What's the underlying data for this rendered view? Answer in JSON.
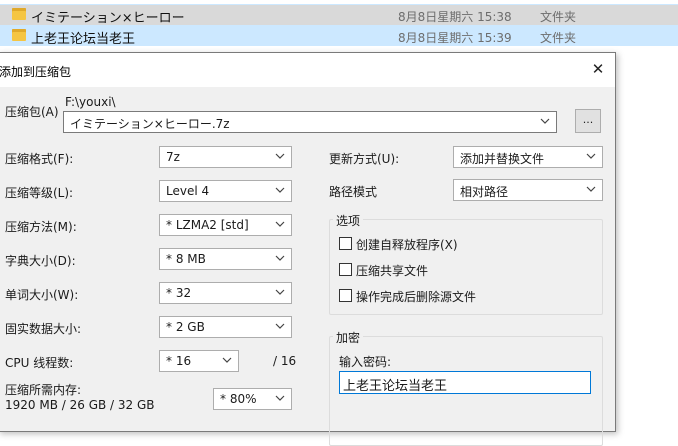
{
  "explorer": {
    "rows": [
      {
        "name": "イミテーション×ヒーロー",
        "date": "8月8日星期六 15:38",
        "type": "文件夹"
      },
      {
        "name": "上老王论坛当老王",
        "date": "8月8日星期六 15:39",
        "type": "文件夹"
      }
    ]
  },
  "dialog": {
    "title": "添加到压缩包",
    "close_glyph": "✕",
    "archive": {
      "label": "压缩包(A)",
      "path": "F:\\youxi\\",
      "filename": "イミテーション×ヒーロー.7z",
      "browse_label": "..."
    },
    "left": {
      "format_label": "压缩格式(F):",
      "format_value": "7z",
      "level_label": "压缩等级(L):",
      "level_value": "Level 4",
      "method_label": "压缩方法(M):",
      "method_value": "* LZMA2 [std]",
      "dict_label": "字典大小(D):",
      "dict_value": "* 8 MB",
      "word_label": "单词大小(W):",
      "word_value": "* 32",
      "solid_label": "固实数据大小:",
      "solid_value": "* 2 GB",
      "cpu_label": "CPU 线程数:",
      "cpu_value": "* 16",
      "cpu_total": "/ 16",
      "mem_label": "压缩所需内存:",
      "mem_value": "1920 MB / 26 GB / 32 GB",
      "mem_percent": "* 80%"
    },
    "right": {
      "update_label": "更新方式(U):",
      "update_value": "添加并替换文件",
      "path_label": "路径模式",
      "path_value": "相对路径",
      "options_title": "选项",
      "options": [
        {
          "label": "创建自释放程序(X)",
          "checked": false
        },
        {
          "label": "压缩共享文件",
          "checked": false
        },
        {
          "label": "操作完成后删除源文件",
          "checked": false
        }
      ],
      "encrypt_title": "加密",
      "password_label": "输入密码:",
      "password_value": "上老王论坛当老王"
    }
  }
}
